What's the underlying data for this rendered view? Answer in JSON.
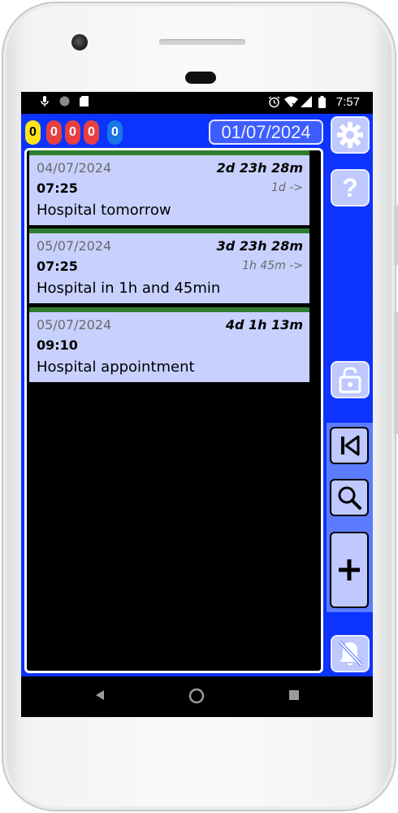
{
  "status_bar": {
    "time": "7:57",
    "left_icons": [
      "microphone-icon",
      "circle-icon",
      "sd-card-icon"
    ],
    "right_icons": [
      "alarm-icon",
      "wifi-icon",
      "signal-icon",
      "battery-icon"
    ]
  },
  "counters": [
    {
      "value": "0",
      "color": "#ffe41a"
    },
    {
      "value": "0",
      "color": "#e84040"
    },
    {
      "value": "0",
      "color": "#e84040"
    },
    {
      "value": "0",
      "color": "#e84040"
    },
    {
      "value": "0",
      "color": "#1976e6"
    }
  ],
  "header": {
    "current_date": "01/07/2024"
  },
  "appointments": [
    {
      "date": "04/07/2024",
      "remaining": "2d 23h 28m",
      "time": "07:25",
      "repeat": "1d  ->",
      "title": "Hospital tomorrow"
    },
    {
      "date": "05/07/2024",
      "remaining": "3d 23h 28m",
      "time": "07:25",
      "repeat": "1h 45m ->",
      "title": "Hospital in 1h and 45min"
    },
    {
      "date": "05/07/2024",
      "remaining": "4d 1h 13m",
      "time": "09:10",
      "repeat": "",
      "title": "Hospital appointment"
    }
  ],
  "side_buttons": [
    "gear-icon",
    "question-icon",
    "lock-icon",
    "skip-back-icon",
    "search-icon",
    "plus-icon",
    "bell-off-icon"
  ],
  "navigation": [
    "back-icon",
    "home-icon",
    "recents-icon"
  ],
  "colors": {
    "app_background": "#0c33ff",
    "card_background": "#c8d1fe",
    "card_accent": "#2f7d32",
    "side_panel": "#5c7cff"
  }
}
